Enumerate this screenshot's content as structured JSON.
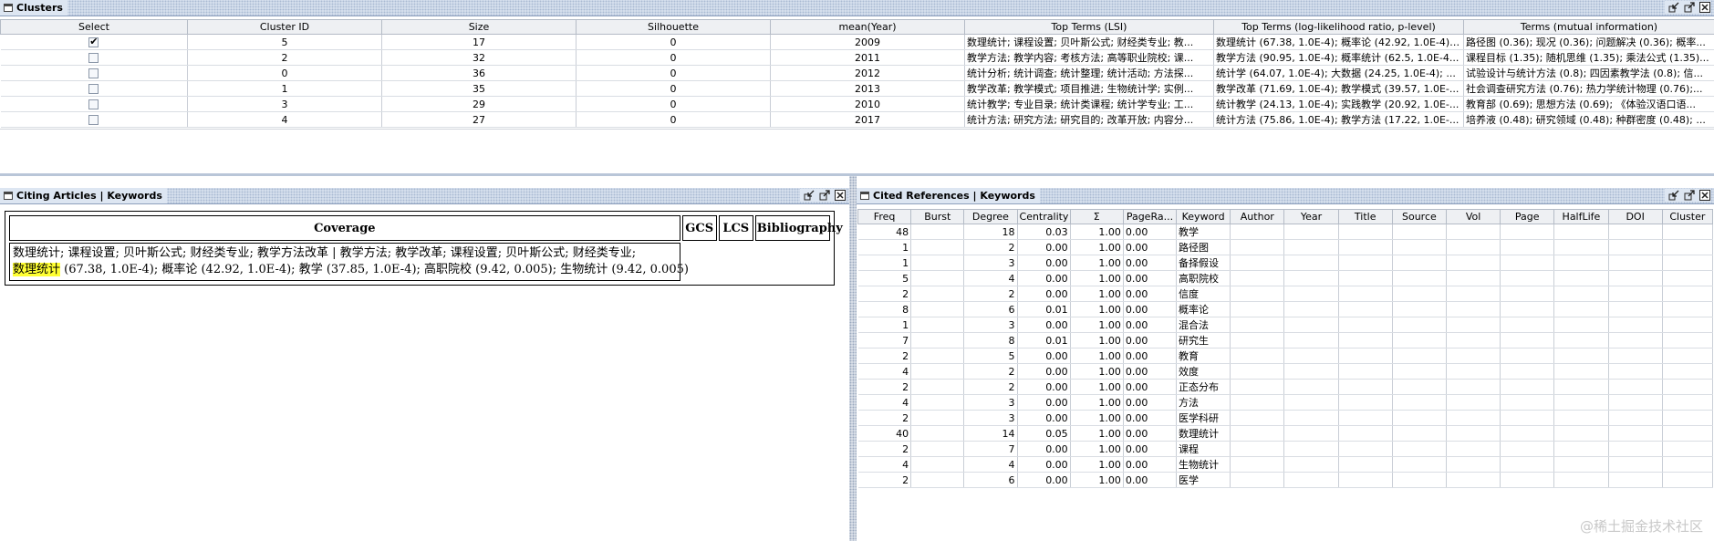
{
  "clusters": {
    "title": "Clusters",
    "columns": [
      "Select",
      "Cluster ID",
      "Size",
      "Silhouette",
      "mean(Year)",
      "Top Terms (LSI)",
      "Top Terms (log-likelihood ratio, p-level)",
      "Terms (mutual information)"
    ],
    "rows": [
      {
        "checked": true,
        "id": "5",
        "size": "17",
        "sil": "0",
        "year": "2009",
        "lsi": "数理统计; 课程设置; 贝叶斯公式; 财经类专业; 教...",
        "llr": "数理统计 (67.38, 1.0E-4); 概率论 (42.92, 1.0E-4);...",
        "mi": "路径图 (0.36); 现况 (0.36); 问题解决 (0.36); 概率..."
      },
      {
        "checked": false,
        "id": "2",
        "size": "32",
        "sil": "0",
        "year": "2011",
        "lsi": "教学方法; 教学内容; 考核方法; 高等职业院校; 课...",
        "llr": "教学方法 (90.95, 1.0E-4); 概率统计 (62.5, 1.0E-4...",
        "mi": "课程目标 (1.35); 随机思维 (1.35); 乘法公式 (1.35)..."
      },
      {
        "checked": false,
        "id": "0",
        "size": "36",
        "sil": "0",
        "year": "2012",
        "lsi": "统计分析; 统计调查; 统计整理; 统计活动; 方法探...",
        "llr": "统计学 (64.07, 1.0E-4); 大数据 (24.25, 1.0E-4); ...",
        "mi": "试验设计与统计方法 (0.8); 四因素教学法 (0.8); 信..."
      },
      {
        "checked": false,
        "id": "1",
        "size": "35",
        "sil": "0",
        "year": "2013",
        "lsi": "教学改革; 教学模式; 项目推进; 生物统计学; 实例...",
        "llr": "教学改革 (71.69, 1.0E-4); 教学模式 (39.57, 1.0E-...",
        "mi": "社会调查研究方法 (0.76); 热力学统计物理 (0.76);..."
      },
      {
        "checked": false,
        "id": "3",
        "size": "29",
        "sil": "0",
        "year": "2010",
        "lsi": "统计教学; 专业目录; 统计类课程; 统计学专业; 工...",
        "llr": "统计教学 (24.13, 1.0E-4); 实践教学 (20.92, 1.0E-...",
        "mi": "教育部 (0.69); 思想方法 (0.69); 《体验汉语口语..."
      },
      {
        "checked": false,
        "id": "4",
        "size": "27",
        "sil": "0",
        "year": "2017",
        "lsi": "统计方法; 研究方法; 研究目的; 改革开放; 内容分...",
        "llr": "统计方法 (75.86, 1.0E-4); 教学方法 (17.22, 1.0E-...",
        "mi": "培养液 (0.48); 研究领域 (0.48); 种群密度 (0.48); ..."
      }
    ]
  },
  "citing": {
    "title": "Citing Articles | Keywords",
    "columns": [
      "Coverage",
      "GCS",
      "LCS",
      "Bibliography"
    ],
    "line1": "数理统计; 课程设置; 贝叶斯公式; 财经类专业; 教学方法改革 | 教学方法; 教学改革; 课程设置; 贝叶斯公式; 财经类专业;",
    "highlight": "数理统计",
    "line2_rest": " (67.38, 1.0E-4); 概率论 (42.92, 1.0E-4); 教学 (37.85, 1.0E-4); 高职院校 (9.42, 0.005); 生物统计 (9.42, 0.005)"
  },
  "cited": {
    "title": "Cited References | Keywords",
    "columns": [
      "Freq",
      "Burst",
      "Degree",
      "Centrality",
      "Σ",
      "PageRa...",
      "Keyword",
      "Author",
      "Year",
      "Title",
      "Source",
      "Vol",
      "Page",
      "HalfLife",
      "DOI",
      "Cluster"
    ],
    "rows": [
      {
        "freq": "48",
        "degree": "18",
        "cent": "0.03",
        "sigma": "1.00",
        "pr": "0.00",
        "kw": "教学"
      },
      {
        "freq": "1",
        "degree": "2",
        "cent": "0.00",
        "sigma": "1.00",
        "pr": "0.00",
        "kw": "路径图"
      },
      {
        "freq": "1",
        "degree": "3",
        "cent": "0.00",
        "sigma": "1.00",
        "pr": "0.00",
        "kw": "备择假设"
      },
      {
        "freq": "5",
        "degree": "4",
        "cent": "0.00",
        "sigma": "1.00",
        "pr": "0.00",
        "kw": "高职院校"
      },
      {
        "freq": "2",
        "degree": "2",
        "cent": "0.00",
        "sigma": "1.00",
        "pr": "0.00",
        "kw": "信度"
      },
      {
        "freq": "8",
        "degree": "6",
        "cent": "0.01",
        "sigma": "1.00",
        "pr": "0.00",
        "kw": "概率论"
      },
      {
        "freq": "1",
        "degree": "3",
        "cent": "0.00",
        "sigma": "1.00",
        "pr": "0.00",
        "kw": "混合法"
      },
      {
        "freq": "7",
        "degree": "8",
        "cent": "0.01",
        "sigma": "1.00",
        "pr": "0.00",
        "kw": "研究生"
      },
      {
        "freq": "2",
        "degree": "5",
        "cent": "0.00",
        "sigma": "1.00",
        "pr": "0.00",
        "kw": "教育"
      },
      {
        "freq": "4",
        "degree": "2",
        "cent": "0.00",
        "sigma": "1.00",
        "pr": "0.00",
        "kw": "效度"
      },
      {
        "freq": "2",
        "degree": "2",
        "cent": "0.00",
        "sigma": "1.00",
        "pr": "0.00",
        "kw": "正态分布"
      },
      {
        "freq": "4",
        "degree": "3",
        "cent": "0.00",
        "sigma": "1.00",
        "pr": "0.00",
        "kw": "方法"
      },
      {
        "freq": "2",
        "degree": "3",
        "cent": "0.00",
        "sigma": "1.00",
        "pr": "0.00",
        "kw": "医学科研"
      },
      {
        "freq": "40",
        "degree": "14",
        "cent": "0.05",
        "sigma": "1.00",
        "pr": "0.00",
        "kw": "数理统计"
      },
      {
        "freq": "2",
        "degree": "7",
        "cent": "0.00",
        "sigma": "1.00",
        "pr": "0.00",
        "kw": "课程"
      },
      {
        "freq": "4",
        "degree": "4",
        "cent": "0.00",
        "sigma": "1.00",
        "pr": "0.00",
        "kw": "生物统计"
      },
      {
        "freq": "2",
        "degree": "6",
        "cent": "0.00",
        "sigma": "1.00",
        "pr": "0.00",
        "kw": "医学"
      }
    ]
  },
  "watermark": "@稀土掘金技术社区",
  "icons": {
    "panel": "frame-icon",
    "dock": "dock-icon",
    "undock": "undock-icon",
    "close": "close-icon"
  },
  "colors": {
    "titlebar": "#dde6f2",
    "highlight": "#ffff33",
    "grid_header": "#eef0f3"
  }
}
